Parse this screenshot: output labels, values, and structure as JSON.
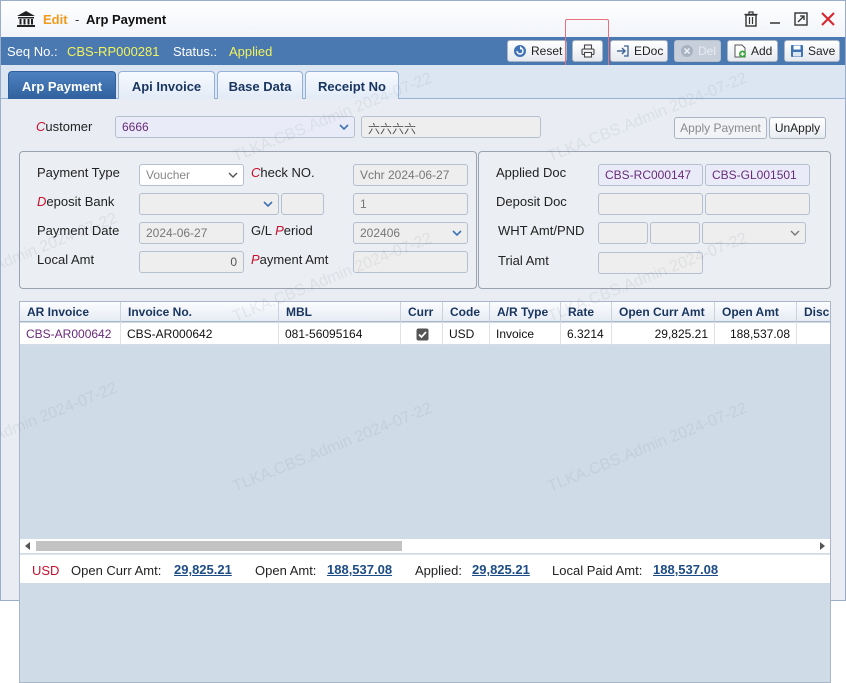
{
  "window": {
    "edit_label": "Edit",
    "separator": "-",
    "title": "Arp Payment"
  },
  "infobar": {
    "seq_label": "Seq No.:",
    "seq_value": "CBS-RP000281",
    "status_label": "Status.:",
    "status_value": "Applied"
  },
  "toolbar": {
    "reset": "Reset",
    "edoc": "EDoc",
    "del": "Del",
    "add": "Add",
    "save": "Save"
  },
  "tabs": [
    {
      "label": "Arp Payment"
    },
    {
      "label": "Api Invoice"
    },
    {
      "label": "Base Data"
    },
    {
      "label": "Receipt No"
    }
  ],
  "customer": {
    "label_first": "C",
    "label_rest": "ustomer",
    "value": "6666",
    "name": "六六六六",
    "apply_label": "Apply Payment",
    "unapply_label": "UnApply"
  },
  "form": {
    "payment_type": {
      "label": "Payment Type",
      "value": "Voucher"
    },
    "check_no": {
      "label_first": "C",
      "label_rest": "heck NO.",
      "value": "Vchr 2024-06-27"
    },
    "deposit_bank": {
      "label_first": "D",
      "label_rest": "eposit Bank",
      "value": "",
      "extra": "",
      "seq": "1"
    },
    "payment_date": {
      "label": "Payment Date",
      "value": "2024-06-27"
    },
    "gl_period": {
      "label_prefix": "G/L ",
      "label_first": "P",
      "label_rest": "eriod",
      "value": "202406"
    },
    "local_amt": {
      "label": "Local Amt",
      "value": "0"
    },
    "payment_amt": {
      "label_first": "P",
      "label_rest": "ayment Amt",
      "value": ""
    },
    "applied_doc": {
      "label": "Applied Doc",
      "value1": "CBS-RC000147",
      "value2": "CBS-GL001501"
    },
    "deposit_doc": {
      "label": "Deposit Doc"
    },
    "wht_amt": {
      "label": "WHT Amt/PND"
    },
    "trial_amt": {
      "label": "Trial Amt"
    }
  },
  "grid": {
    "columns": [
      "AR Invoice",
      "Invoice No.",
      "MBL",
      "Curr",
      "Code",
      "A/R Type",
      "Rate",
      "Open Curr Amt",
      "Open Amt",
      "Disc"
    ],
    "rows": [
      {
        "ar_invoice": "CBS-AR000642",
        "invoice_no": "CBS-AR000642",
        "mbl": "081-56095164",
        "curr_checked": true,
        "code": "USD",
        "ar_type": "Invoice",
        "rate": "6.3214",
        "open_curr_amt": "29,825.21",
        "open_amt": "188,537.08",
        "disc": ""
      }
    ]
  },
  "footer": {
    "currency": "USD",
    "open_curr_label": "Open Curr Amt:",
    "open_curr_value": "29,825.21",
    "open_amt_label": "Open Amt:",
    "open_amt_value": "188,537.08",
    "applied_label": "Applied:",
    "applied_value": "29,825.21",
    "local_paid_label": "Local Paid Amt:",
    "local_paid_value": "188,537.08"
  },
  "watermark": "TLKA.CBS.Admin 2024-07-22",
  "colors": {
    "accent_blue": "#4a78b0",
    "edit_orange": "#f29a1c",
    "status_yellow": "#f3f35b",
    "required_red": "#c8102e",
    "link_purple": "#6a2a7a"
  }
}
